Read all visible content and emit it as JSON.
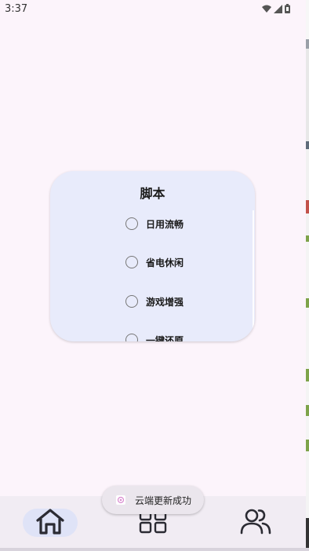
{
  "status_bar": {
    "time": "3:37",
    "icons": [
      "wifi-icon",
      "signal-icon",
      "battery-icon"
    ]
  },
  "dialog": {
    "title": "脚本",
    "options": [
      {
        "label": "日用流畅",
        "selected": false
      },
      {
        "label": "省电休闲",
        "selected": false
      },
      {
        "label": "游戏增强",
        "selected": false
      },
      {
        "label": "一键还原",
        "selected": false
      }
    ]
  },
  "toast": {
    "message": "云端更新成功",
    "icon": "app-icon"
  },
  "nav": {
    "items": [
      {
        "icon": "home-icon",
        "active": true
      },
      {
        "icon": "grid-icon",
        "active": false
      },
      {
        "icon": "people-icon",
        "active": false
      }
    ]
  },
  "colors": {
    "background": "#fcf4fb",
    "dialog": "#e8ebfb",
    "nav_active": "#dfe3f7",
    "nav_bar": "#f1ecf3"
  }
}
